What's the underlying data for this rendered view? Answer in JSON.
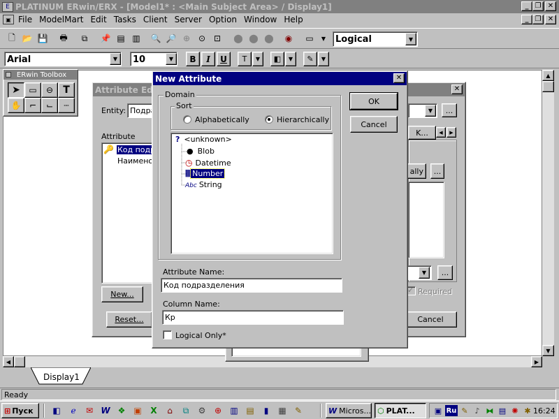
{
  "app": {
    "title": "PLATINUM ERwin/ERX - [Model1* : <Main Subject Area> / Display1]",
    "menu": [
      "File",
      "ModelMart",
      "Edit",
      "Tasks",
      "Client",
      "Server",
      "Option",
      "Window",
      "Help"
    ],
    "view_mode": "Logical",
    "font_name": "Arial",
    "font_size": "10",
    "format_buttons": {
      "bold": "B",
      "italic": "I",
      "underline": "U"
    },
    "display_tab": "Display1",
    "status": "Ready"
  },
  "toolbox": {
    "title": "ERwin Toolbox",
    "tools": [
      "pointer-tool",
      "entity-tool",
      "subtype-tool",
      "text-tool",
      "hand-tool",
      "identifying-relationship-tool",
      "many-to-many-relationship-tool",
      "non-identifying-relationship-tool"
    ]
  },
  "attribute_editor": {
    "title": "Attribute Editor",
    "entity_label": "Entity:",
    "entity_value": "Подразделение",
    "attribute_label": "Attribute",
    "attributes": [
      "Код подразделения",
      "Наименование"
    ],
    "new_button": "New...",
    "reset_button": "Reset...",
    "cancel_button": "Cancel",
    "tab_label": "K...",
    "required_label": "Required",
    "ally_button": "ally"
  },
  "dialog": {
    "title": "New Attribute",
    "domain_label": "Domain",
    "sort_label": "Sort",
    "sort_alpha": "Alphabetically",
    "sort_hier": "Hierarchically",
    "sort_selected": "Hierarchically",
    "ok_button": "OK",
    "cancel_button": "Cancel",
    "domains": [
      {
        "label": "<unknown>",
        "icon": "unknown-domain-icon"
      },
      {
        "label": "Blob",
        "icon": "blob-domain-icon"
      },
      {
        "label": "Datetime",
        "icon": "datetime-domain-icon"
      },
      {
        "label": "Number",
        "icon": "number-domain-icon",
        "selected": true
      },
      {
        "label": "String",
        "icon": "string-domain-icon"
      }
    ],
    "attribute_name_label": "Attribute Name:",
    "attribute_name_value": "Код подразделения",
    "column_name_label": "Column Name:",
    "column_name_value": "Кр",
    "logical_only_label": "Logical Only*",
    "logical_only_checked": false
  },
  "taskbar": {
    "start_label": "Пуск",
    "tasks": [
      {
        "label": "Micros...",
        "active": false
      },
      {
        "label": "PLAT...",
        "active": true
      }
    ],
    "language": "Ru",
    "clock": "16:24"
  },
  "colors": {
    "title_active": "#000080",
    "title_inactive": "#808080",
    "face": "#c0c0c0",
    "desktop_bg": "#ffffff",
    "selection": "#000080"
  }
}
